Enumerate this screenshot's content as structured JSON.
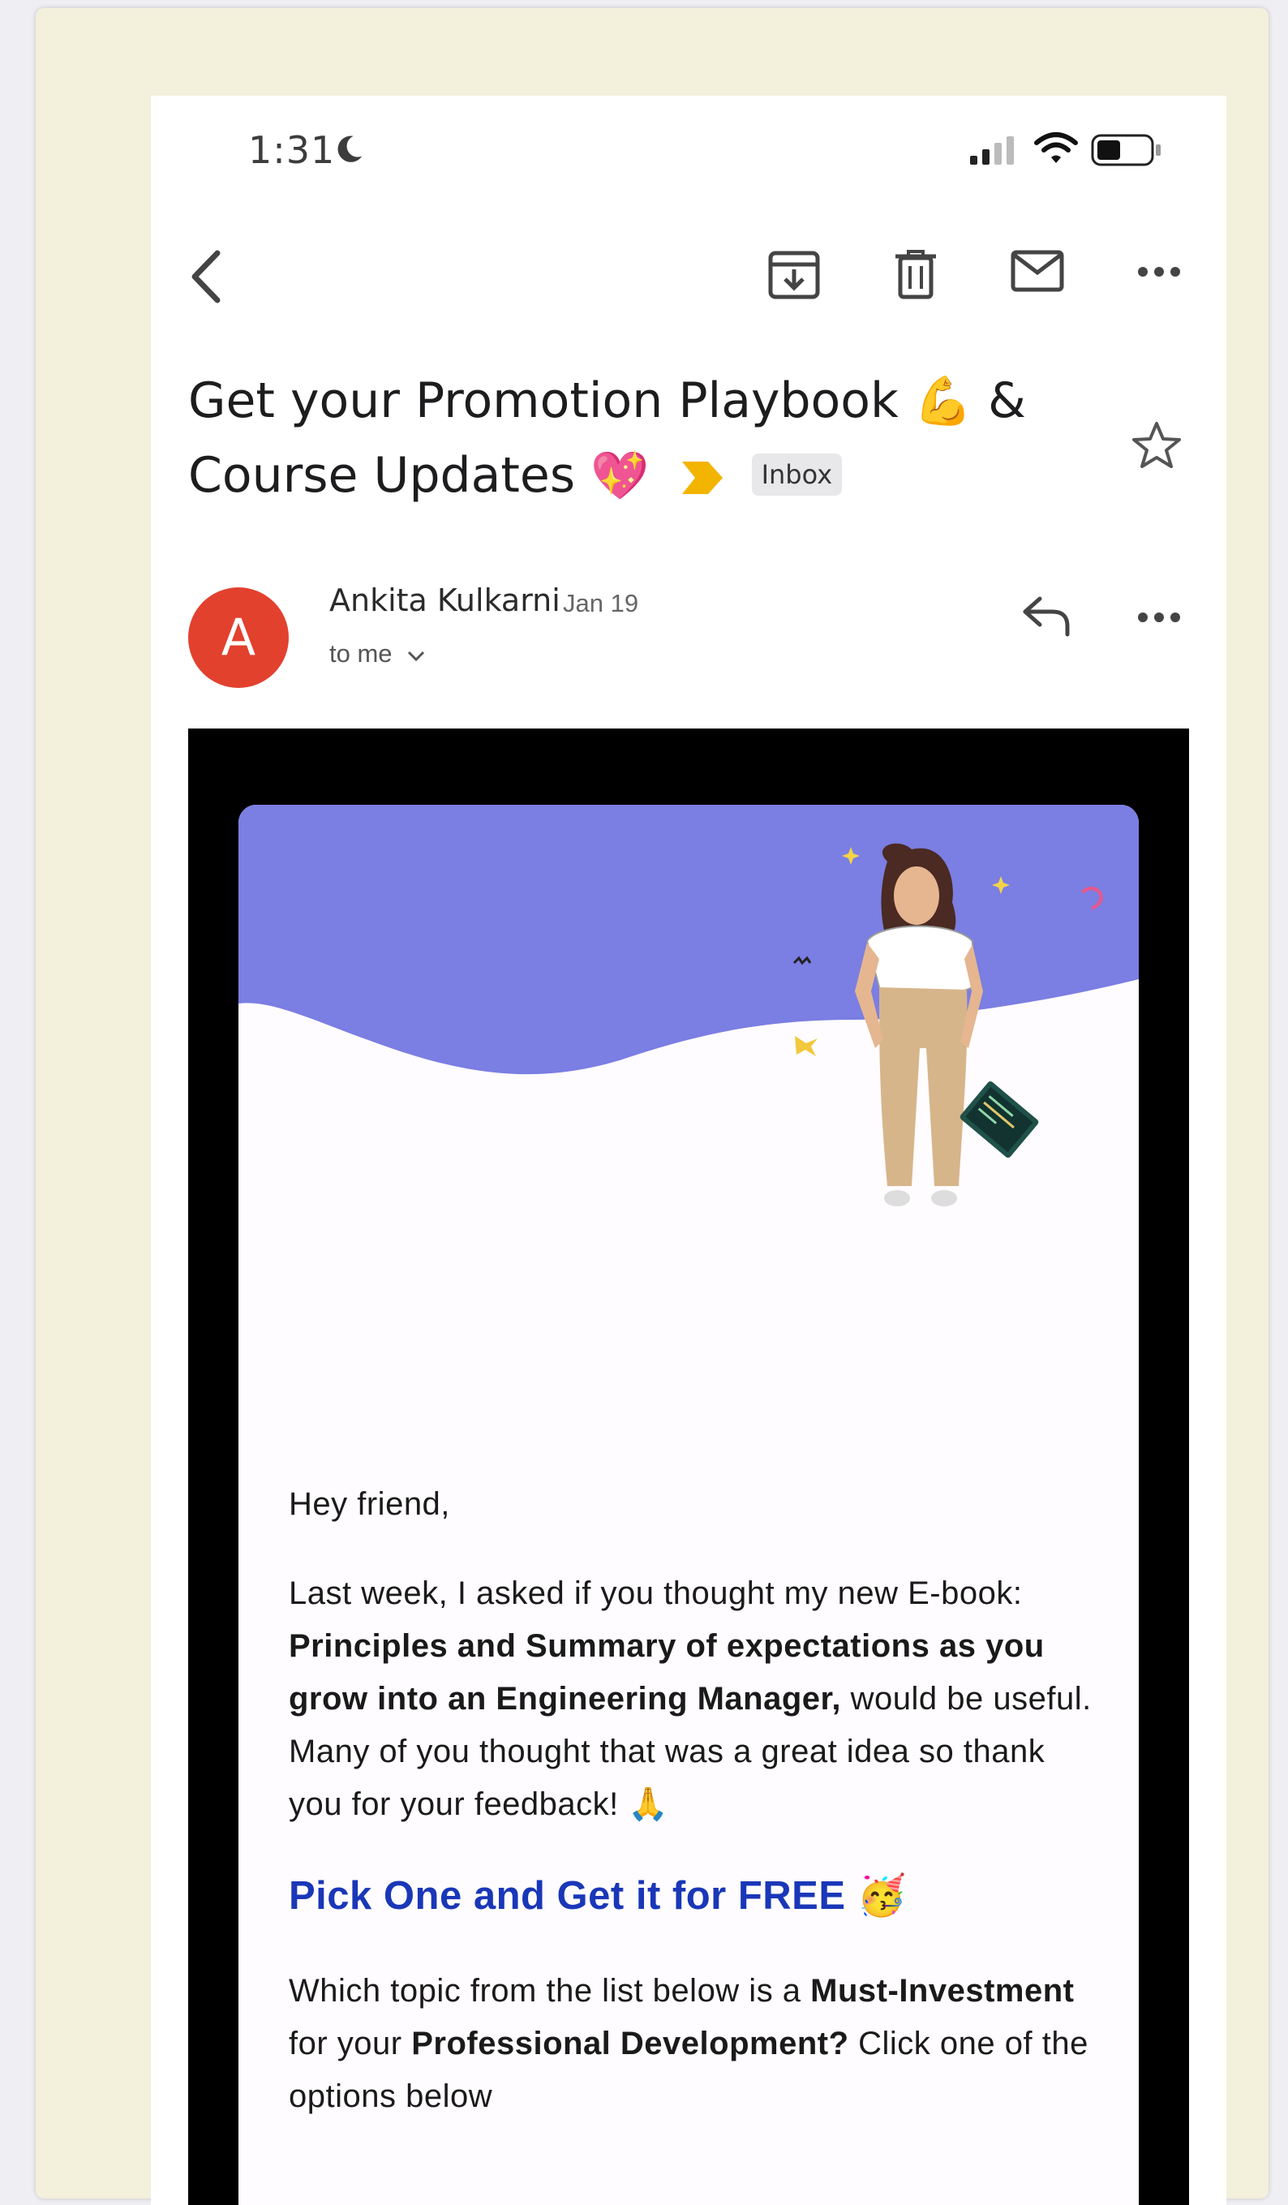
{
  "status_bar": {
    "time": "1:31"
  },
  "toolbar": {
    "back": "back-icon",
    "archive": "archive-icon",
    "delete": "trash-icon",
    "mark_unread": "mail-icon",
    "more": "more-icon"
  },
  "email": {
    "subject_line1": "Get your Promotion Playbook",
    "subject_emoji1": "💪",
    "subject_amp": "&",
    "subject_line2": "Course Updates",
    "subject_emoji2": "💖",
    "label": "Inbox",
    "sender": {
      "initial": "A",
      "name": "Ankita Kulkarni",
      "date": "Jan 19",
      "recipient": "to me"
    },
    "body": {
      "greeting": "Hey friend,",
      "p1_a": "Last week, I asked if you thought my new E-book: ",
      "p1_b": "Principles and Summary of expectations as you grow into an Engineering Manager,",
      "p1_c": " would be useful. Many of you thought that was a great idea so thank you for your feedback! ",
      "p1_emoji": "🙏",
      "promo_heading": "Pick One and Get it for FREE",
      "promo_emoji": "🥳",
      "p2_a": "Which topic from the list below is a ",
      "p2_b": "Must-Investment",
      "p2_c": " for your ",
      "p2_d": "Professional Development?",
      "p2_e": " Click one of the options below"
    }
  },
  "colors": {
    "avatar": "#e2412e",
    "hero_purple": "#7b7ee2",
    "promo_blue": "#1a37b8",
    "important_marker": "#f3b400"
  }
}
